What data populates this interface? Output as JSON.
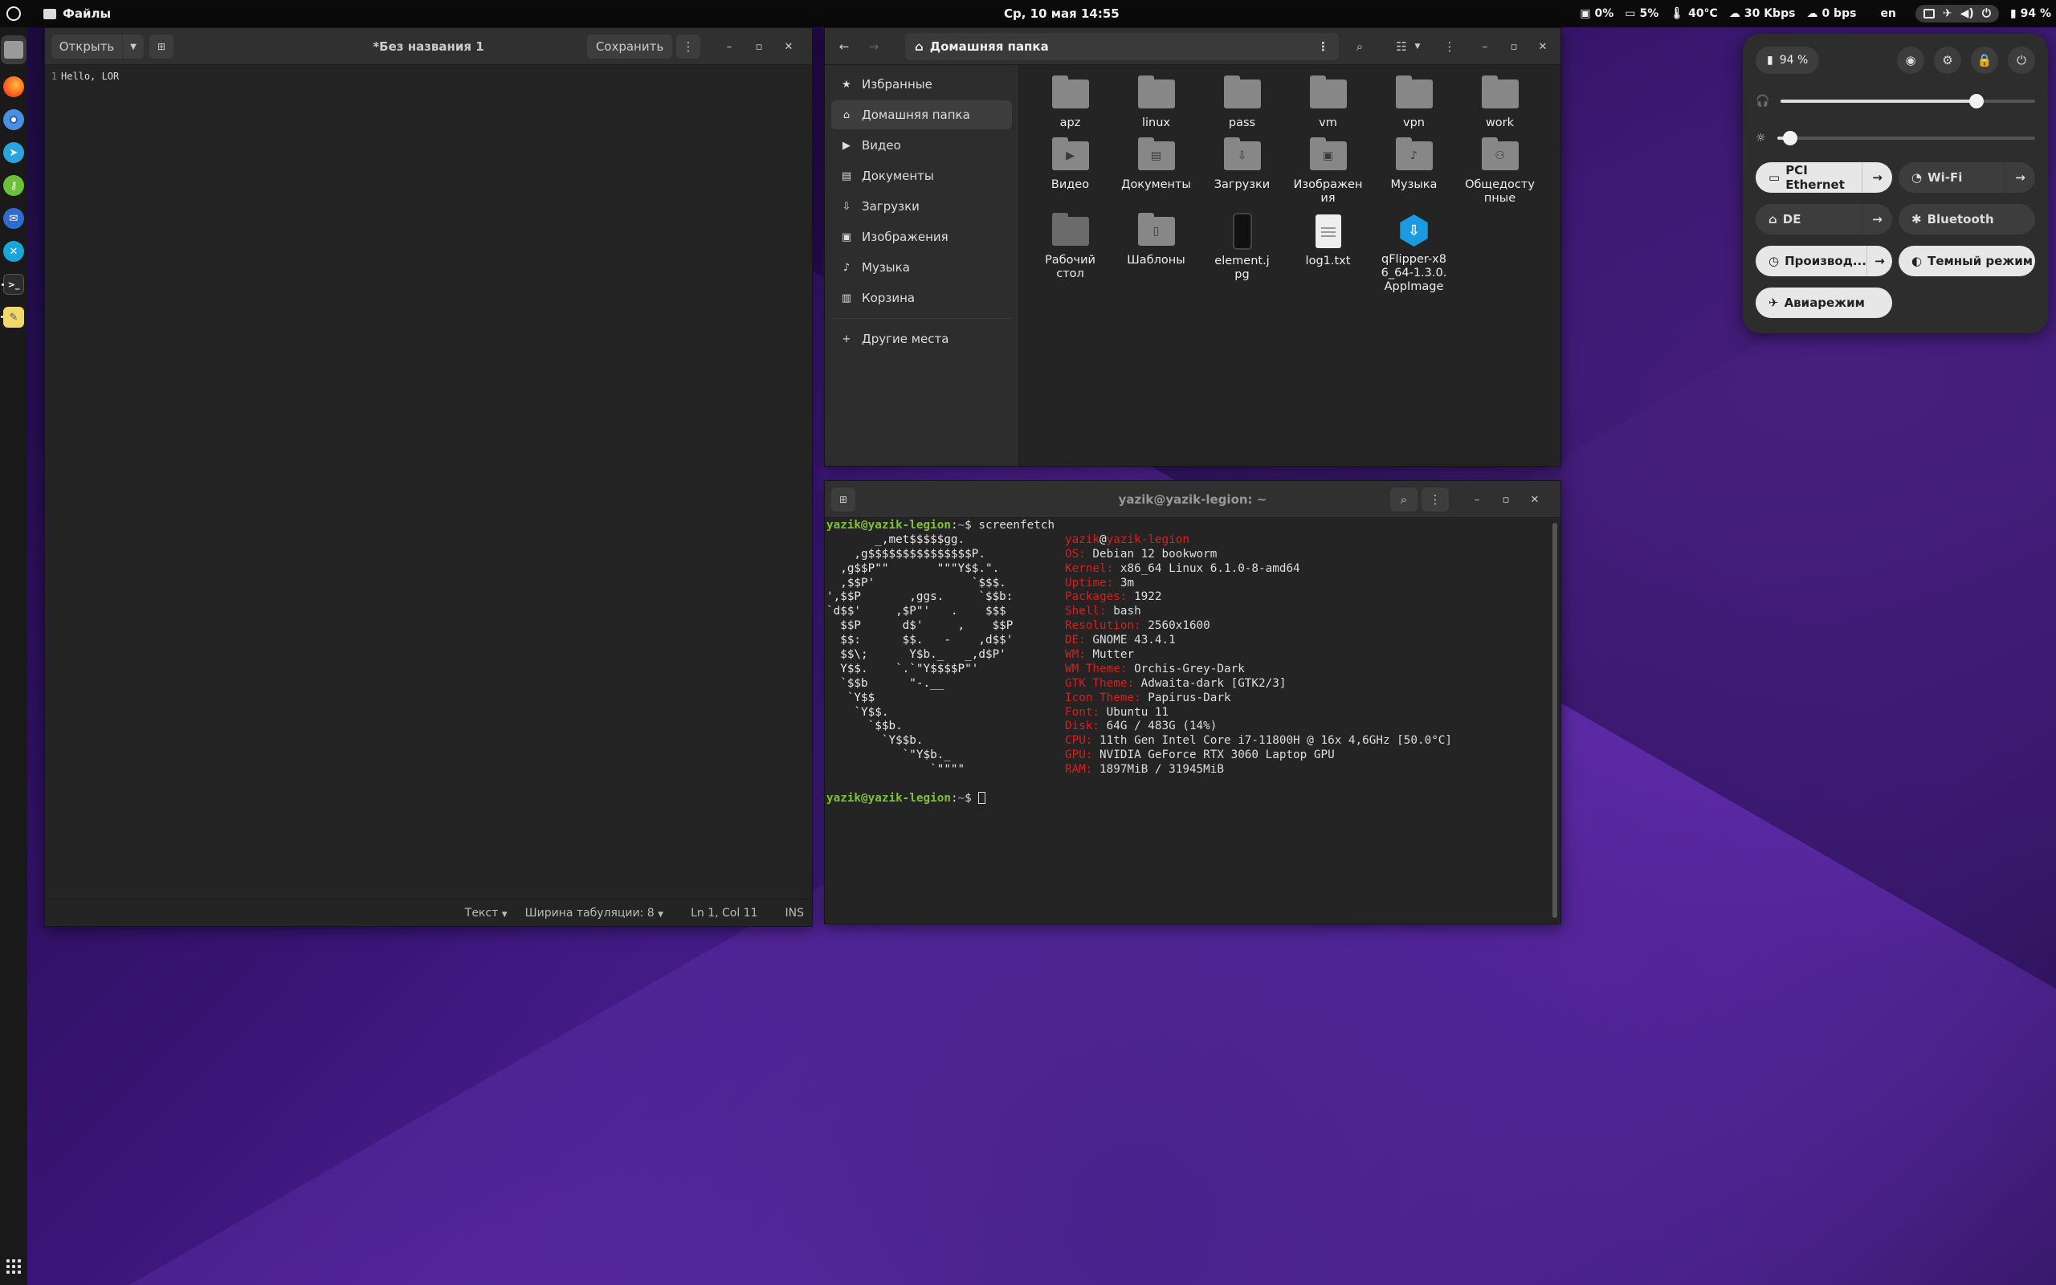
{
  "topbar": {
    "app_name": "Файлы",
    "clock": "Ср, 10 мая  14:55",
    "indicators": [
      {
        "icon": "disk-icon",
        "value": "0%"
      },
      {
        "icon": "monitor-icon",
        "value": "5%"
      },
      {
        "icon": "temperature-icon",
        "value": "40°C"
      },
      {
        "icon": "download-icon",
        "value": "30 Kbps"
      },
      {
        "icon": "upload-icon",
        "value": "0 bps"
      }
    ],
    "lang": "en",
    "battery": "94 %"
  },
  "dock": {
    "items": [
      {
        "name": "files",
        "color": "#9a9a9a",
        "glyph": "",
        "active": true
      },
      {
        "name": "firefox",
        "color": "#ff7139",
        "glyph": ""
      },
      {
        "name": "chromium",
        "color": "#4a90e2",
        "glyph": ""
      },
      {
        "name": "telegram",
        "color": "#2aa3e0",
        "glyph": "➤"
      },
      {
        "name": "keepass",
        "color": "#6bbf3a",
        "glyph": "⚷"
      },
      {
        "name": "thunderbird",
        "color": "#2f6ccf",
        "glyph": ""
      },
      {
        "name": "remmina",
        "color": "#1aa6d9",
        "glyph": "✕"
      },
      {
        "name": "terminal",
        "color": "#2c2c2c",
        "glyph": ">_"
      },
      {
        "name": "text-editor",
        "color": "#f2d86a",
        "glyph": "✎"
      }
    ]
  },
  "editor": {
    "open_label": "Открыть",
    "title": "*Без названия 1",
    "save_label": "Сохранить",
    "line_number": "1",
    "content": "Hello, LOR",
    "status": {
      "lang": "Текст",
      "tab_width": "Ширина табуляции: 8",
      "position": "Ln 1, Col 11",
      "mode": "INS"
    }
  },
  "files": {
    "path": "Домашняя папка",
    "sidebar": [
      {
        "label": "Избранные",
        "icon": "star-icon",
        "glyph": "★"
      },
      {
        "label": "Домашняя папка",
        "icon": "home-icon",
        "glyph": "⌂",
        "selected": true
      },
      {
        "label": "Видео",
        "icon": "video-icon",
        "glyph": "▶"
      },
      {
        "label": "Документы",
        "icon": "document-icon",
        "glyph": "▤"
      },
      {
        "label": "Загрузки",
        "icon": "download-icon",
        "glyph": "⇩"
      },
      {
        "label": "Изображения",
        "icon": "image-icon",
        "glyph": "▣"
      },
      {
        "label": "Музыка",
        "icon": "music-icon",
        "glyph": "♪"
      },
      {
        "label": "Корзина",
        "icon": "trash-icon",
        "glyph": "🗑"
      }
    ],
    "other_places": "Другие места",
    "items": [
      {
        "label": "apz",
        "type": "folder"
      },
      {
        "label": "linux",
        "type": "folder"
      },
      {
        "label": "pass",
        "type": "folder"
      },
      {
        "label": "vm",
        "type": "folder"
      },
      {
        "label": "vpn",
        "type": "folder"
      },
      {
        "label": "work",
        "type": "folder"
      },
      {
        "label": "Видео",
        "type": "folder",
        "glyph": "▶"
      },
      {
        "label": "Документы",
        "type": "folder",
        "glyph": "▤"
      },
      {
        "label": "Загрузки",
        "type": "folder",
        "glyph": "⇩"
      },
      {
        "label": "Изображения",
        "type": "folder",
        "glyph": "▣"
      },
      {
        "label": "Музыка",
        "type": "folder",
        "glyph": "♪"
      },
      {
        "label": "Общедоступные",
        "type": "folder",
        "glyph": "⚇"
      },
      {
        "label": "Рабочий стол",
        "type": "folder-dim"
      },
      {
        "label": "Шаблоны",
        "type": "folder",
        "glyph": "▯"
      },
      {
        "label": "element.jpg",
        "type": "image"
      },
      {
        "label": "log1.txt",
        "type": "text"
      },
      {
        "label": "qFlipper-x86_64-1.3.0.AppImage",
        "type": "app"
      }
    ]
  },
  "terminal": {
    "title": "yazik@yazik-legion: ~",
    "prompt_user": "yazik@yazik-legion",
    "prompt_path": "~",
    "command": "screenfetch",
    "art": [
      "       _,met$$$$$gg.",
      "    ,g$$$$$$$$$$$$$$$P.",
      "  ,g$$P\"\"       \"\"\"Y$$.\".",
      "  ,$$P'              `$$$.",
      "',$$P       ,ggs.     `$$b:",
      "`d$$'     ,$P\"'   .    $$$",
      "  $$P      d$'     ,    $$P",
      "  $$:      $$.   -    ,d$$'",
      "  $$\\;      Y$b._   _,d$P'",
      "  Y$$.    `.`\"Y$$$$P\"'",
      "  `$$b      \"-.__",
      "   `Y$$",
      "    `Y$$.",
      "      `$$b.",
      "        `Y$$b.",
      "           `\"Y$b._",
      "               `\"\"\"\"",
      ""
    ],
    "info": [
      {
        "k": "yazik",
        "v": "",
        "host": "@yazik-legion"
      },
      {
        "k": "OS:",
        "v": " Debian 12 bookworm"
      },
      {
        "k": "Kernel:",
        "v": " x86_64 Linux 6.1.0-8-amd64"
      },
      {
        "k": "Uptime:",
        "v": " 3m"
      },
      {
        "k": "Packages:",
        "v": " 1922"
      },
      {
        "k": "Shell:",
        "v": " bash"
      },
      {
        "k": "Resolution:",
        "v": " 2560x1600"
      },
      {
        "k": "DE:",
        "v": " GNOME 43.4.1"
      },
      {
        "k": "WM:",
        "v": " Mutter"
      },
      {
        "k": "WM Theme:",
        "v": " Orchis-Grey-Dark"
      },
      {
        "k": "GTK Theme:",
        "v": " Adwaita-dark [GTK2/3]"
      },
      {
        "k": "Icon Theme:",
        "v": " Papirus-Dark"
      },
      {
        "k": "Font:",
        "v": " Ubuntu 11"
      },
      {
        "k": "Disk:",
        "v": " 64G / 483G (14%)"
      },
      {
        "k": "CPU:",
        "v": " 11th Gen Intel Core i7-11800H @ 16x 4,6GHz [50.0°C]"
      },
      {
        "k": "GPU:",
        "v": " NVIDIA GeForce RTX 3060 Laptop GPU"
      },
      {
        "k": "RAM:",
        "v": " 1897MiB / 31945MiB"
      },
      {
        "k": "",
        "v": ""
      }
    ]
  },
  "quick_settings": {
    "battery": "94 %",
    "volume_level": 0.77,
    "brightness_level": 0.05,
    "tiles": [
      {
        "label": "PCI Ethernet",
        "icon": "ethernet-icon",
        "glyph": "▭",
        "on": true,
        "arrow": true
      },
      {
        "label": "Wi-Fi",
        "icon": "wifi-icon",
        "glyph": "◔",
        "on": false,
        "arrow": true
      },
      {
        "label": "DE",
        "icon": "vpn-icon",
        "glyph": "⌂",
        "on": false,
        "arrow": true
      },
      {
        "label": "Bluetooth",
        "icon": "bluetooth-icon",
        "glyph": "✱",
        "on": false,
        "arrow": false
      },
      {
        "label": "Производ...",
        "icon": "power-mode-icon",
        "glyph": "◷",
        "on": true,
        "arrow": true
      },
      {
        "label": "Темный режим",
        "icon": "dark-mode-icon",
        "glyph": "◐",
        "on": true,
        "arrow": false
      },
      {
        "label": "Авиарежим",
        "icon": "airplane-icon",
        "glyph": "✈",
        "on": true,
        "arrow": false
      }
    ]
  },
  "colors": {
    "accent": "#3584e4",
    "prompt_green": "#7ec13a",
    "prompt_blue": "#5f94d6",
    "debian_red": "#d81e1e"
  }
}
